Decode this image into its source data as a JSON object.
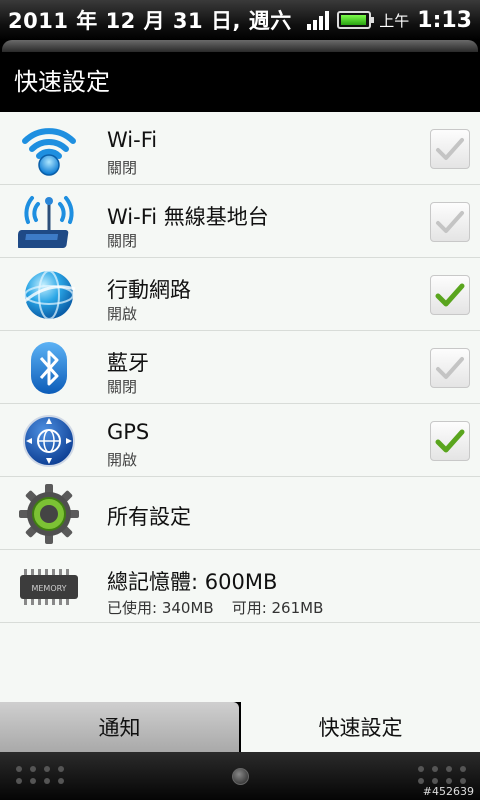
{
  "status_bar": {
    "date": "2011 年 12 月 31 日, 週六",
    "ampm": "上午",
    "time": "1:13"
  },
  "panel": {
    "title": "快速設定"
  },
  "settings": [
    {
      "title": "Wi-Fi",
      "status": "關閉",
      "checked": false,
      "icon": "wifi-icon"
    },
    {
      "title": "Wi-Fi 無線基地台",
      "status": "關閉",
      "checked": false,
      "icon": "wifi-hotspot-icon"
    },
    {
      "title": "行動網路",
      "status": "開啟",
      "checked": true,
      "icon": "mobile-network-globe-icon"
    },
    {
      "title": "藍牙",
      "status": "關閉",
      "checked": false,
      "icon": "bluetooth-icon"
    },
    {
      "title": "GPS",
      "status": "開啟",
      "checked": true,
      "icon": "gps-icon"
    }
  ],
  "all_settings": {
    "title": "所有設定",
    "icon": "gear-icon"
  },
  "memory": {
    "title": "總記憶體: 600MB",
    "used": "已使用: 340MB",
    "free": "可用: 261MB",
    "chip_label": "MEMORY",
    "icon": "memory-chip-icon"
  },
  "tabs": [
    {
      "label": "通知",
      "active": false
    },
    {
      "label": "快速設定",
      "active": true
    }
  ],
  "watermark": "#452639",
  "colors": {
    "check_on": "#5aa51e",
    "check_off": "#bdbdbd",
    "list_bg": "#f5f8f5"
  }
}
